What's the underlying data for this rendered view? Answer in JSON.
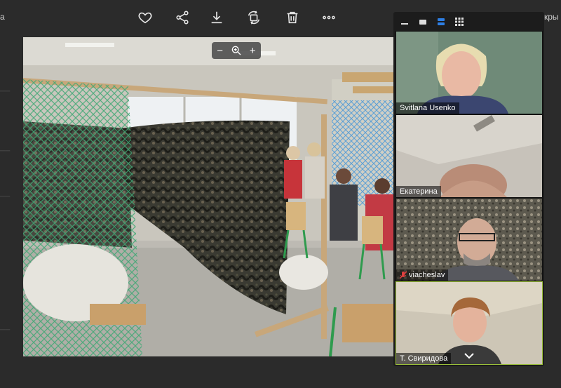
{
  "top": {
    "left_fragment": "a",
    "right_fragment": "кры"
  },
  "photo_zoom": {
    "minus": "−",
    "plus": "+"
  },
  "participants": [
    {
      "name": "Svitlana Usenko",
      "muted": false,
      "active": false
    },
    {
      "name": "Екатерина",
      "muted": false,
      "active": false
    },
    {
      "name": "viacheslav",
      "muted": true,
      "active": false
    },
    {
      "name": "Т. Свиридова",
      "muted": false,
      "active": true
    }
  ],
  "colors": {
    "active_border": "#9bc03a",
    "layout_selected": "#2d7ee3"
  }
}
